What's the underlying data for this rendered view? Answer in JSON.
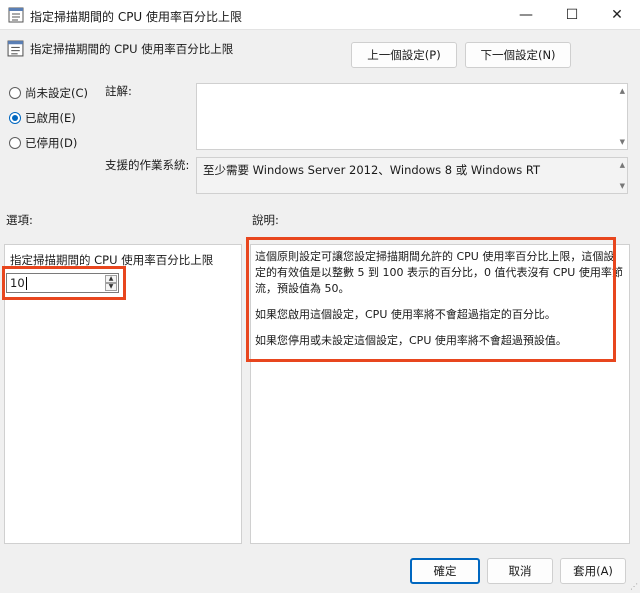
{
  "window": {
    "title": "指定掃描期間的 CPU 使用率百分比上限",
    "minimize_glyph": "—",
    "maximize_glyph": "☐",
    "close_glyph": "✕"
  },
  "header": {
    "title": "指定掃描期間的 CPU 使用率百分比上限",
    "prev_button": "上一個設定(P)",
    "next_button": "下一個設定(N)"
  },
  "state": {
    "not_configured": "尚未設定(C)",
    "enabled": "已啟用(E)",
    "disabled": "已停用(D)",
    "selected": "enabled"
  },
  "comment": {
    "label": "註解:"
  },
  "supported": {
    "label": "支援的作業系統:",
    "value": "至少需要 Windows Server 2012、Windows 8 或 Windows RT"
  },
  "options": {
    "label": "選項:",
    "field_label": "指定掃描期間的 CPU 使用率百分比上限",
    "value": "10"
  },
  "help": {
    "label": "說明:",
    "paragraphs": [
      "這個原則設定可讓您設定掃描期間允許的 CPU 使用率百分比上限，這個設定的有效值是以整數 5 到 100 表示的百分比，0 值代表沒有 CPU 使用率節流，預設值為 50。",
      "如果您啟用這個設定，CPU 使用率將不會超過指定的百分比。",
      "如果您停用或未設定這個設定，CPU 使用率將不會超過預設值。"
    ]
  },
  "footer": {
    "ok": "確定",
    "cancel": "取消",
    "apply": "套用(A)"
  },
  "colors": {
    "accent": "#0067c0",
    "highlight": "#e8461e"
  },
  "icons": [
    "policy-icon",
    "spin-up-icon",
    "spin-down-icon",
    "resize-grip-icon"
  ]
}
